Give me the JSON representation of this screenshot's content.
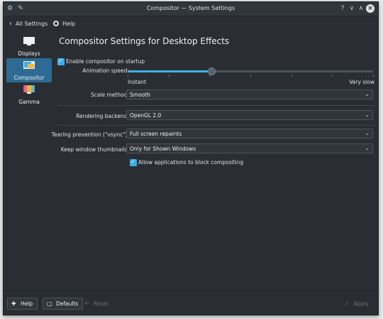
{
  "window": {
    "title": "Compositor — System Settings",
    "titlebar_buttons": [
      "?",
      "∨",
      "∧",
      "×"
    ]
  },
  "toolbar": {
    "back_label": "All Settings",
    "help_label": "Help"
  },
  "sidebar": {
    "items": [
      {
        "label": "Displays",
        "icon": "display-icon",
        "active": false
      },
      {
        "label": "Compositor",
        "icon": "compositor-icon",
        "active": true
      },
      {
        "label": "Gamma",
        "icon": "gamma-icon",
        "active": false
      }
    ]
  },
  "page": {
    "title": "Compositor Settings for Desktop Effects",
    "enable_on_startup": {
      "label": "Enable compositor on startup",
      "checked": true
    },
    "animation_speed": {
      "label": "Animation speed:",
      "min_label": "Instant",
      "max_label": "Very slow",
      "value_fraction": 0.34
    },
    "scale_method": {
      "label": "Scale method:",
      "value": "Smooth"
    },
    "rendering_backend": {
      "label": "Rendering backend:",
      "value": "OpenGL 2.0"
    },
    "tearing_prevention": {
      "label": "Tearing prevention (\"vsync\"):",
      "value": "Full screen repaints"
    },
    "keep_thumbnails": {
      "label": "Keep window thumbnails:",
      "value": "Only for Shown Windows"
    },
    "allow_block": {
      "label": "Allow applications to block compositing",
      "checked": true
    }
  },
  "footer": {
    "help_label": "Help",
    "defaults_label": "Defaults",
    "reset_label": "Reset",
    "apply_label": "Apply"
  },
  "colors": {
    "accent": "#3daee9",
    "background": "#2a2e32",
    "selected": "#2d6b94"
  }
}
